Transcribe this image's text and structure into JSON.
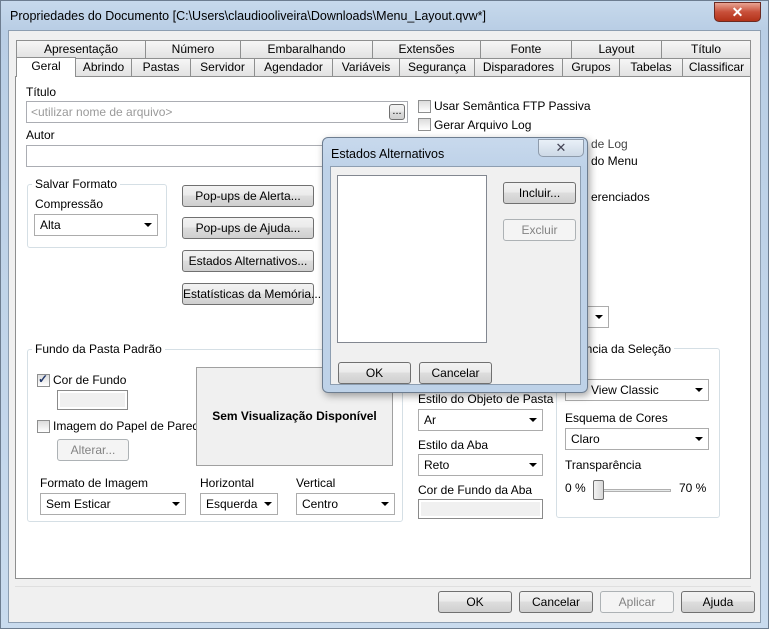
{
  "window": {
    "title": "Propriedades do Documento [C:\\Users\\claudiooliveira\\Downloads\\Menu_Layout.qvw*]",
    "close_glyph": "✕"
  },
  "tabs_row1": [
    "Apresentação",
    "Número",
    "Embaralhando",
    "Extensões",
    "Fonte",
    "Layout",
    "Título"
  ],
  "tabs_row2": [
    "Geral",
    "Abrindo",
    "Pastas",
    "Servidor",
    "Agendador",
    "Variáveis",
    "Segurança",
    "Disparadores",
    "Grupos",
    "Tabelas",
    "Classificar"
  ],
  "general": {
    "title_label": "Título",
    "title_placeholder": "<utilizar nome de arquivo>",
    "browse_label": "...",
    "author_label": "Autor",
    "author_value": "",
    "save_format": {
      "group_label": "Salvar Formato",
      "compression_label": "Compressão",
      "compression_value": "Alta"
    },
    "buttons": {
      "alert_popups": "Pop-ups de Alerta...",
      "help_popups": "Pop-ups de Ajuda...",
      "alt_states": "Estados Alternativos...",
      "memory_stats": "Estatísticas da Memória..."
    },
    "checkboxes": {
      "ftp_semantics": "Usar Semântica FTP Passiva",
      "generate_log": "Gerar Arquivo Log",
      "log_partial": "de Log",
      "menu_partial": "do Menu",
      "diff_partial": "erenciados"
    },
    "background": {
      "group_label": "Fundo da Pasta Padrão",
      "bg_color_label": "Cor de Fundo",
      "bg_color_checked": true,
      "wallpaper_label": "Imagem do Papel de Parede",
      "wallpaper_checked": false,
      "change_button": "Alterar...",
      "preview_text": "Sem Visualização Disponível",
      "image_format_label": "Formato de Imagem",
      "image_format_value": "Sem Esticar",
      "horizontal_label": "Horizontal",
      "horizontal_value": "Esquerda",
      "vertical_label": "Vertical",
      "vertical_value": "Centro"
    },
    "styling": {
      "sheet_object_style_label": "Estilo do Objeto de Pasta",
      "sheet_object_style_value": "Ar",
      "tab_style_label": "Estilo da Aba",
      "tab_style_value": "Reto",
      "tab_bg_color_label": "Cor de Fundo da Aba"
    },
    "selection": {
      "group_label_partial": "ência da Seleção",
      "style_value_partial": "View Classic",
      "color_scheme_label": "Esquema de Cores",
      "color_scheme_value": "Claro",
      "transparency_label": "Transparência",
      "transparency_min": "0 %",
      "transparency_max": "70 %",
      "transparency_value": 0
    }
  },
  "footer": {
    "ok": "OK",
    "cancel": "Cancelar",
    "apply": "Aplicar",
    "help": "Ajuda"
  },
  "dialog": {
    "title": "Estados Alternativos",
    "close_glyph": "✕",
    "add_button": "Incluir...",
    "delete_button": "Excluir",
    "ok_button": "OK",
    "cancel_button": "Cancelar",
    "states": []
  },
  "colors": {
    "chrome": "#c7d9ec",
    "close_red": "#c8503a",
    "face": "#f0f0f0"
  }
}
